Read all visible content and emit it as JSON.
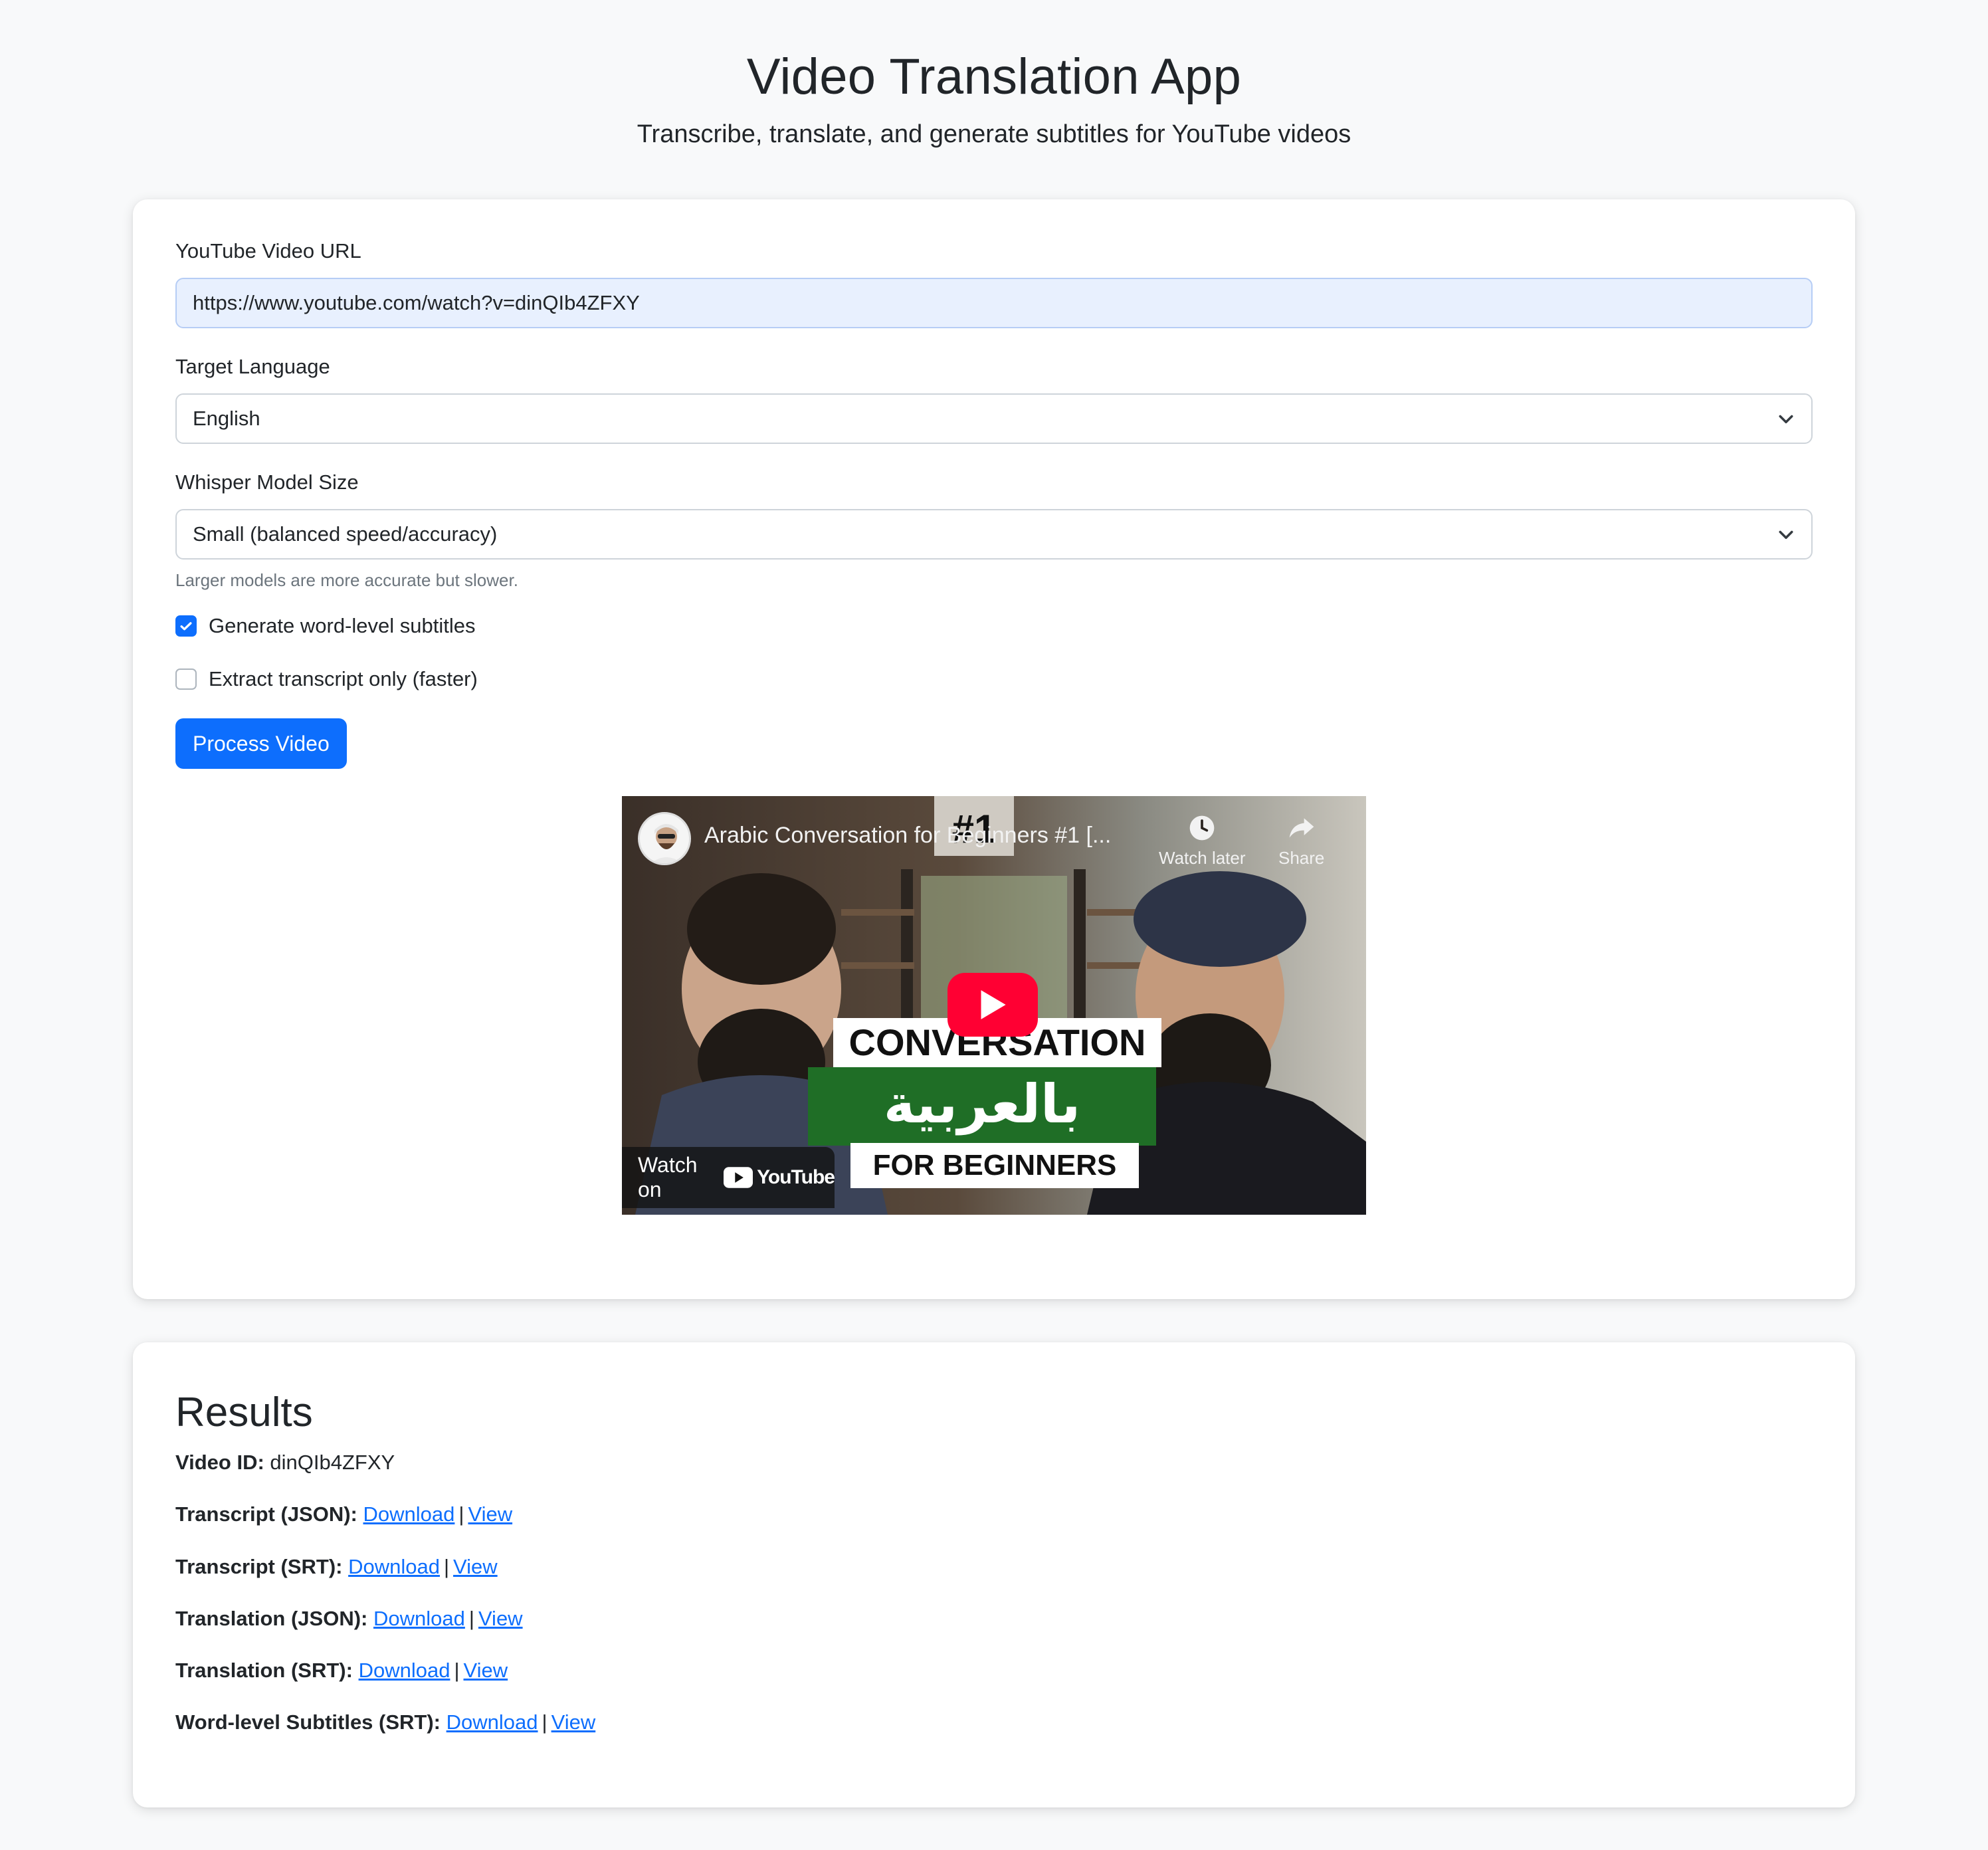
{
  "header": {
    "title": "Video Translation App",
    "subtitle": "Transcribe, translate, and generate subtitles for YouTube videos"
  },
  "form": {
    "url_label": "YouTube Video URL",
    "url_value": "https://www.youtube.com/watch?v=dinQIb4ZFXY",
    "language_label": "Target Language",
    "language_value": "English",
    "model_label": "Whisper Model Size",
    "model_value": "Small (balanced speed/accuracy)",
    "model_help": "Larger models are more accurate but slower.",
    "word_level_label": "Generate word-level subtitles",
    "word_level_checked": true,
    "transcript_only_label": "Extract transcript only (faster)",
    "transcript_only_checked": false,
    "submit_label": "Process Video"
  },
  "video": {
    "title": "Arabic Conversation for Beginners #1 [...",
    "watch_later": "Watch later",
    "share": "Share",
    "watch_on": "Watch on",
    "youtube": "YouTube",
    "thumb_number": "#1",
    "thumb_line1": "CONVERSATION",
    "thumb_line2": "بالعربية",
    "thumb_line3": "FOR BEGINNERS"
  },
  "results": {
    "title": "Results",
    "video_id_label": "Video ID:",
    "video_id": "dinQIb4ZFXY",
    "download": "Download",
    "view": "View",
    "separator": "|",
    "files": [
      {
        "label": "Transcript (JSON):"
      },
      {
        "label": "Transcript (SRT):"
      },
      {
        "label": "Translation (JSON):"
      },
      {
        "label": "Translation (SRT):"
      },
      {
        "label": "Word-level Subtitles (SRT):"
      }
    ]
  },
  "colors": {
    "primary": "#0d6efd",
    "background": "#f8f9fa",
    "youtube_red": "#ff0033"
  }
}
